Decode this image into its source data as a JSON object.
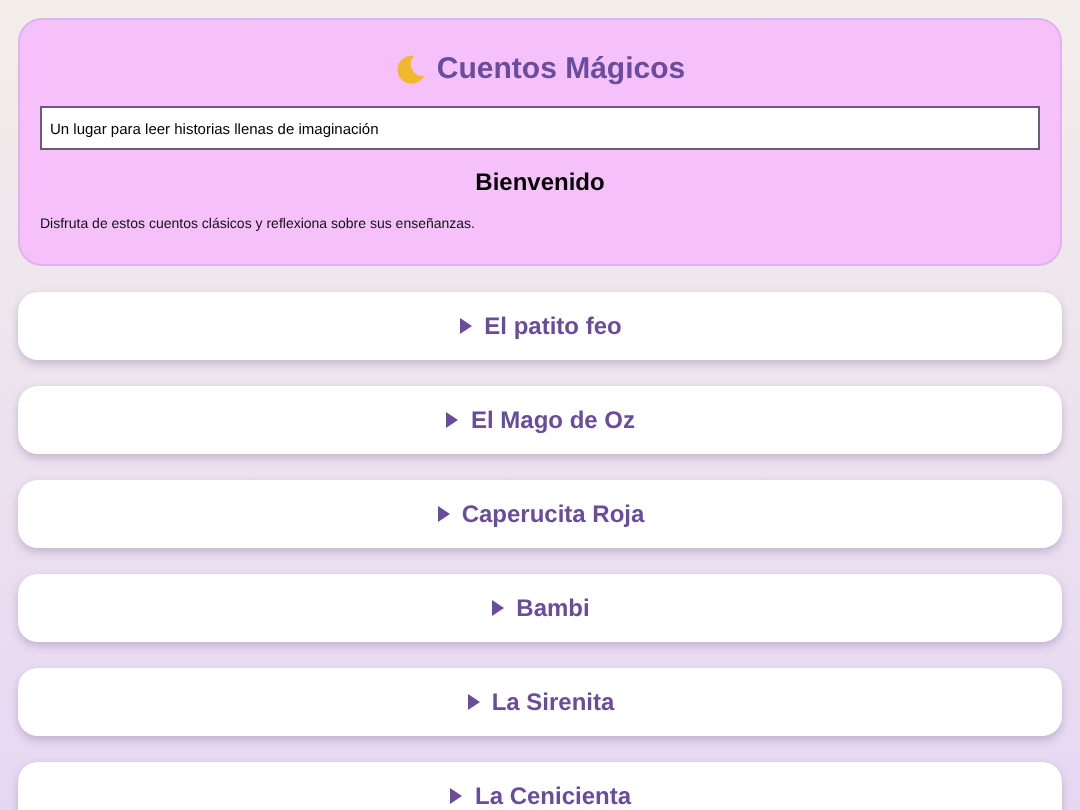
{
  "header": {
    "title": "Cuentos Mágicos",
    "tagline_field": {
      "value": "Un lugar para leer historias llenas de imaginación"
    },
    "heading": "Bienvenido",
    "intro": "Disfruta de estos cuentos clásicos y reflexiona sobre sus enseñanzas."
  },
  "stories": [
    {
      "title": "El patito feo",
      "expanded": false
    },
    {
      "title": "El Mago de Oz",
      "expanded": false
    },
    {
      "title": "Caperucita Roja",
      "expanded": false
    },
    {
      "title": "Bambi",
      "expanded": false
    },
    {
      "title": "La Sirenita",
      "expanded": false
    },
    {
      "title": "La Cenicienta",
      "expanded": false
    }
  ]
}
